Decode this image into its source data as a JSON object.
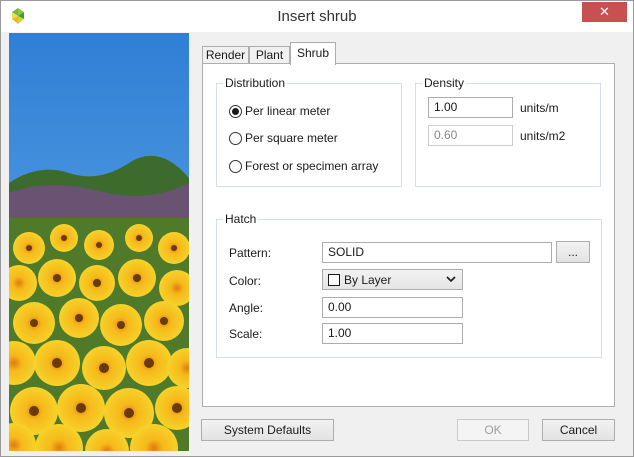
{
  "window": {
    "title": "Insert shrub",
    "close_glyph": "✕",
    "colors": {
      "close_bg": "#c75050",
      "border": "#9a9a9a",
      "panel_bg": "#f0f0f0"
    }
  },
  "photo": {
    "description_icon": "yellow-flowers-photo"
  },
  "tabs": [
    {
      "label": "Render"
    },
    {
      "label": "Plant"
    },
    {
      "label": "Shrub"
    }
  ],
  "active_tab": "Shrub",
  "distribution": {
    "title": "Distribution",
    "options": [
      {
        "label": "Per linear meter",
        "checked": true
      },
      {
        "label": "Per square meter",
        "checked": false
      },
      {
        "label": "Forest or specimen array",
        "checked": false
      }
    ]
  },
  "density": {
    "title": "Density",
    "linear_value": "1.00",
    "linear_unit": "units/m",
    "square_value": "0.60",
    "square_unit": "units/m2"
  },
  "hatch": {
    "title": "Hatch",
    "pattern_label": "Pattern:",
    "pattern_value": "SOLID",
    "browse_label": "...",
    "color_label": "Color:",
    "color_value": "By Layer",
    "angle_label": "Angle:",
    "angle_value": "0.00",
    "scale_label": "Scale:",
    "scale_value": "1.00"
  },
  "footer": {
    "system_defaults": "System Defaults",
    "ok": "OK",
    "cancel": "Cancel"
  }
}
